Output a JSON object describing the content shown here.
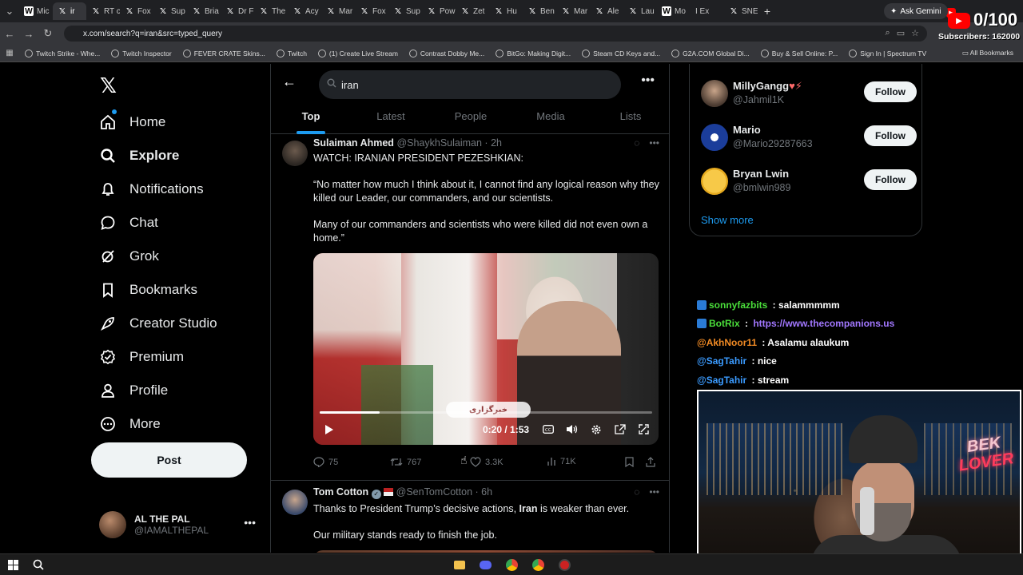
{
  "browser": {
    "tabs": [
      {
        "label": "Mic",
        "icon": "w"
      },
      {
        "label": "ir",
        "icon": "x",
        "active": true
      },
      {
        "label": "RT c",
        "icon": "x"
      },
      {
        "label": "Fox",
        "icon": "x"
      },
      {
        "label": "Sup",
        "icon": "x"
      },
      {
        "label": "Bria",
        "icon": "x"
      },
      {
        "label": "Dr F",
        "icon": "x"
      },
      {
        "label": "The",
        "icon": "x"
      },
      {
        "label": "Acy",
        "icon": "x"
      },
      {
        "label": "Mar",
        "icon": "x"
      },
      {
        "label": "Fox",
        "icon": "x"
      },
      {
        "label": "Sup",
        "icon": "x"
      },
      {
        "label": "Pow",
        "icon": "x"
      },
      {
        "label": "Zet",
        "icon": "x"
      },
      {
        "label": "Hu",
        "icon": "x"
      },
      {
        "label": "Ben",
        "icon": "x"
      },
      {
        "label": "Mar",
        "icon": "x"
      },
      {
        "label": "Ale",
        "icon": "x"
      },
      {
        "label": "Lau",
        "icon": "x"
      },
      {
        "label": "Mo",
        "icon": "w"
      },
      {
        "label": "I Ex",
        "icon": "yt"
      },
      {
        "label": "SNE",
        "icon": "x"
      }
    ],
    "gemini_label": "Ask Gemini",
    "url": "x.com/search?q=iran&src=typed_query",
    "bookmarks": [
      "Twitch Strike - Whe...",
      "Twitch Inspector",
      "FEVER CRATE Skins...",
      "Twitch",
      "(1) Create Live Stream",
      "Contrast Dobby Me...",
      "BitGo: Making Digit...",
      "Steam CD Keys and...",
      "G2A.COM Global Di...",
      "Buy & Sell Online: P...",
      "Sign In | Spectrum TV"
    ],
    "all_bookmarks": "All Bookmarks"
  },
  "sidebar": {
    "items": [
      {
        "label": "Home",
        "icon": "home-icon"
      },
      {
        "label": "Explore",
        "icon": "search-icon"
      },
      {
        "label": "Notifications",
        "icon": "bell-icon"
      },
      {
        "label": "Chat",
        "icon": "chat-icon"
      },
      {
        "label": "Grok",
        "icon": "grok-icon"
      },
      {
        "label": "Bookmarks",
        "icon": "bookmark-icon"
      },
      {
        "label": "Creator Studio",
        "icon": "rocket-icon"
      },
      {
        "label": "Premium",
        "icon": "premium-icon"
      },
      {
        "label": "Profile",
        "icon": "person-icon"
      },
      {
        "label": "More",
        "icon": "more-circle-icon"
      }
    ],
    "post_label": "Post",
    "account": {
      "name": "AL THE PAL",
      "handle": "@IAMALTHEPAL"
    }
  },
  "search": {
    "query": "iran",
    "tabs": [
      "Top",
      "Latest",
      "People",
      "Media",
      "Lists"
    ],
    "active_tab": "Top"
  },
  "tweets": [
    {
      "name": "Sulaiman Ahmed",
      "handle": "@ShaykhSulaiman",
      "time": "2h",
      "lines": [
        "WATCH: IRANIAN PRESIDENT PEZESHKIAN:",
        "“No matter how much I think about it, I cannot find any logical reason why they killed our Leader, our commanders, and our scientists.",
        "Many of our commanders and scientists who were killed did not even own a home.”"
      ],
      "video": {
        "time": "0:20 / 1:53",
        "progress": 0.18,
        "overlay_text": "خبرگزاری"
      },
      "stats": {
        "replies": "75",
        "reposts": "767",
        "likes": "3.3K",
        "views": "71K"
      }
    },
    {
      "name": "Tom Cotton",
      "handle": "@SenTomCotton",
      "time": "6h",
      "line1_pre": "Thanks to President Trump’s decisive actions, ",
      "line1_bold": "Iran",
      "line1_post": " is weaker than ever.",
      "line2": "Our military stands ready to finish the job."
    }
  ],
  "who_to_follow": [
    {
      "name": "MillyGangg",
      "handle": "@Jahmil1K",
      "suffix": "♥⚡"
    },
    {
      "name": "Mario",
      "handle": "@Mario29287663",
      "suffix": ""
    },
    {
      "name": "Bryan Lwin",
      "handle": "@bmlwin989",
      "suffix": ""
    }
  ],
  "follow_label": "Follow",
  "show_more": "Show more",
  "chat": [
    {
      "user": "sonnyfazbits",
      "color": "#4ade3a",
      "msg": " : salammmmm",
      "badges": [
        "blue",
        "green"
      ]
    },
    {
      "user": "BotRix",
      "color": "#4ade3a",
      "msg": " : ",
      "link": "https://www.thecompanions.us",
      "badges": [
        "blue",
        "green"
      ]
    },
    {
      "user": "@AkhNoor11",
      "color": "#f08a24",
      "msg": " : Asalamu alaukum",
      "badges": []
    },
    {
      "user": "@SagTahir",
      "color": "#3b9bff",
      "msg": " : nice",
      "badges": []
    },
    {
      "user": "@SagTahir",
      "color": "#3b9bff",
      "msg": " : stream",
      "badges": []
    }
  ],
  "webcam": {
    "neon_line1": "BEK",
    "neon_line2": "LOVER"
  },
  "yt_overlay": {
    "count": "0/100",
    "subscribers": "Subscribers: 162000"
  },
  "colors": {
    "accent": "#1d9bf0",
    "background": "#000000",
    "border": "#2f3336",
    "muted": "#71767b"
  }
}
